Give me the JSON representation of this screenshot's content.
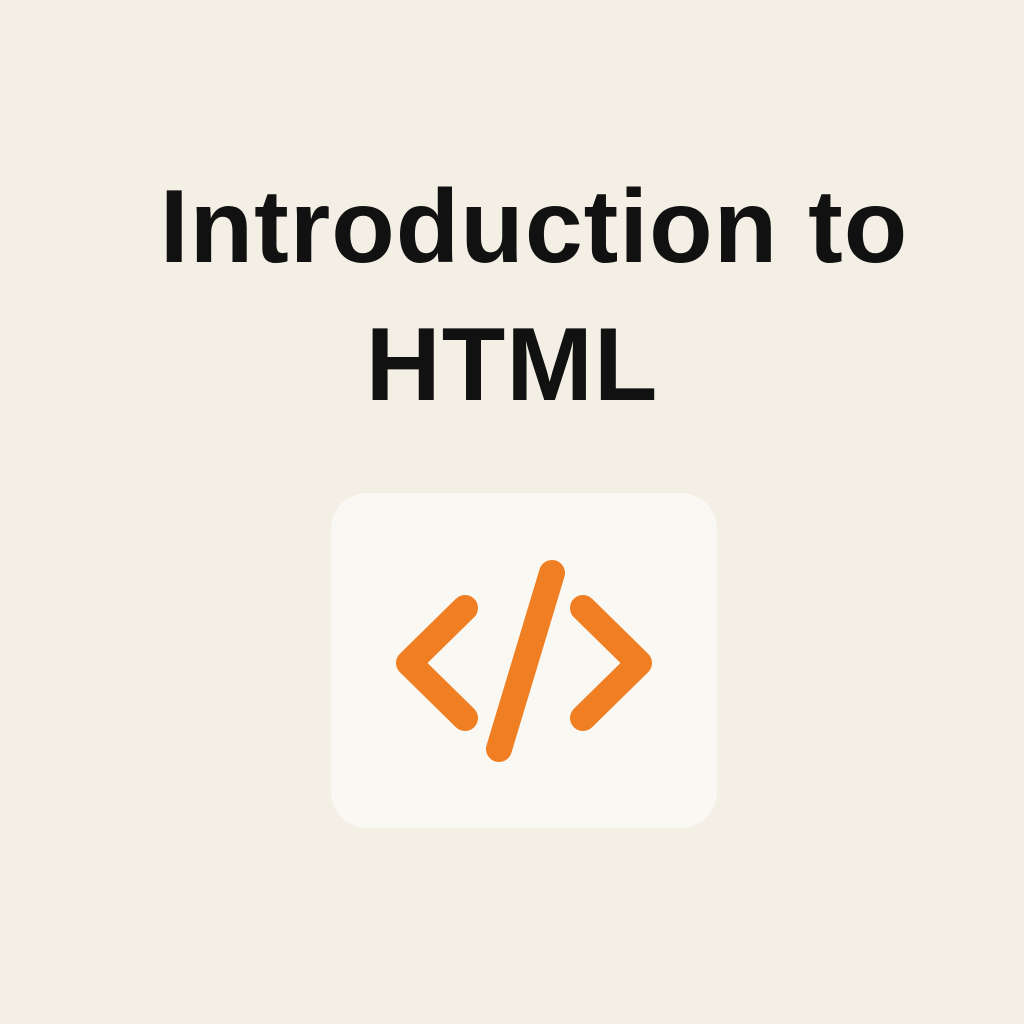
{
  "title": {
    "line1": "Introduction to",
    "line2": "HTML"
  },
  "icon": {
    "name": "code-tag-icon",
    "color": "#f07f24"
  },
  "colors": {
    "background": "#f3efe5",
    "card": "#faf8f3",
    "text": "#111111",
    "accent": "#f07f24"
  }
}
